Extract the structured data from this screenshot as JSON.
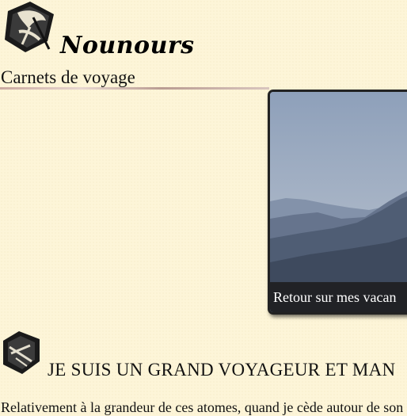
{
  "header": {
    "site_title": "Nounours",
    "tagline": "Carnets de voyage"
  },
  "slider": {
    "caption": "Retour sur mes vacan"
  },
  "section": {
    "title": "JE SUIS UN GRAND VOYAGEUR ET MAN",
    "intro": "Relativement à la grandeur de ces atomes, quand je cède autour de son c"
  },
  "icons": {
    "logo": "feather-logo-icon",
    "section": "quill-icon"
  }
}
